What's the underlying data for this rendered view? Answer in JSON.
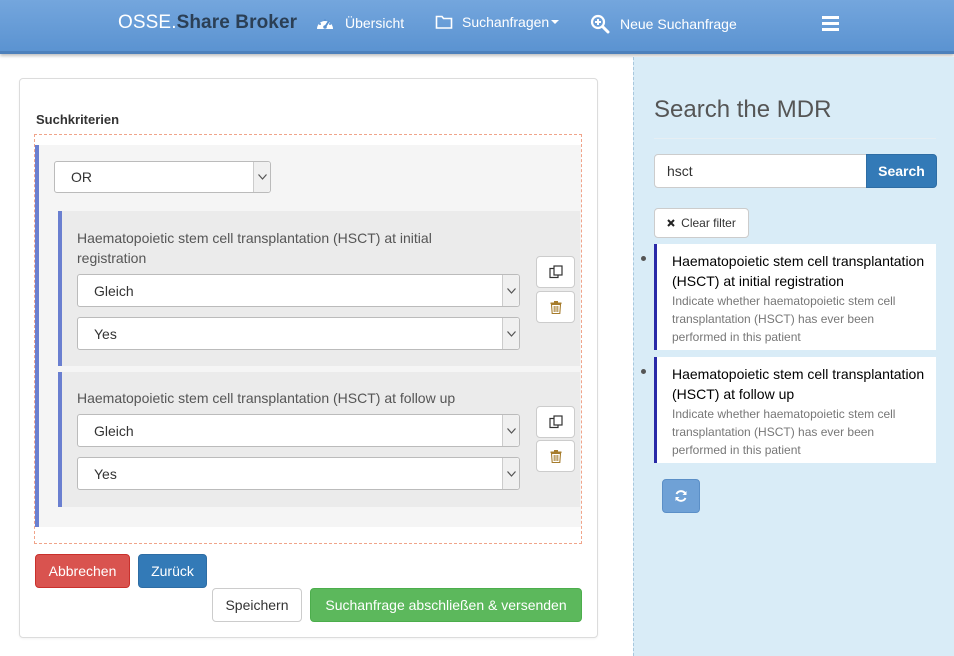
{
  "navbar": {
    "brand_prefix": "OSSE.",
    "brand_suffix": "Share Broker",
    "items": [
      {
        "label": "Übersicht",
        "icon": "dashboard-icon"
      },
      {
        "label": "Suchanfragen",
        "icon": "folder-icon",
        "has_dropdown": true
      },
      {
        "label": "Neue Suchanfrage",
        "icon": "search-plus-icon"
      }
    ],
    "menu_icon": "hamburger-icon"
  },
  "main": {
    "section_title": "Suchkriterien",
    "group_operator": "OR",
    "conditions": [
      {
        "label": "Haematopoietic stem cell transplantation (HSCT) at initial registration",
        "operator": "Gleich",
        "value": "Yes"
      },
      {
        "label": "Haematopoietic stem cell transplantation (HSCT) at follow up",
        "operator": "Gleich",
        "value": "Yes"
      }
    ],
    "buttons": {
      "cancel": "Abbrechen",
      "back": "Zurück",
      "save": "Speichern",
      "submit": "Suchanfrage abschließen & versenden"
    }
  },
  "sidebar": {
    "title": "Search the MDR",
    "search_value": "hsct",
    "search_button": "Search",
    "clear_filter": "Clear filter",
    "results": [
      {
        "title": "Haematopoietic stem cell transplantation (HSCT) at initial registration",
        "description": "Indicate whether haematopoietic stem cell transplantation (HSCT) has ever been performed in this patient"
      },
      {
        "title": "Haematopoietic stem cell transplantation (HSCT) at follow up",
        "description": "Indicate whether haematopoietic stem cell transplantation (HSCT) has ever been performed in this patient"
      }
    ]
  },
  "colors": {
    "navbar": "#5b93d1",
    "brand_dark": "#2b3f55",
    "danger": "#d9534f",
    "primary": "#337ab7",
    "success": "#5cb85c",
    "sidebar_bg": "#d9ecf7",
    "group_border": "#6a7fd0"
  }
}
